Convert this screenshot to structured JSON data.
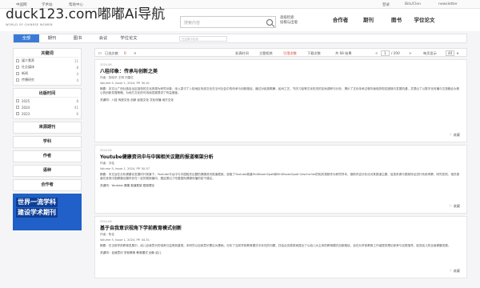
{
  "topbar": {
    "home": "中国网",
    "platform": "学术站",
    "help": "帮助中心",
    "right_a": "登录",
    "right_b": "Bits/Clen",
    "right_c": "newsletter"
  },
  "watermark": "duck123.com嘟嘟Ai导航",
  "logo_en": "WORLD OF CHINESE WOMEN",
  "search": {
    "placeholder": "搜索内容"
  },
  "header": {
    "link1": "高级检索",
    "link2": "投稿与出版"
  },
  "pubs": [
    "合作者",
    "期刊",
    "图书",
    "学位论文"
  ],
  "nav": {
    "tabs": [
      "全部",
      "期刊",
      "图书",
      "会议",
      "学位论文"
    ],
    "active": 0,
    "sub_placeholder": "在结果中检索"
  },
  "filters": [
    {
      "title": "关键词",
      "items": [
        {
          "label": "媒介素养",
          "count": "11"
        },
        {
          "label": "社交媒体",
          "count": "8"
        },
        {
          "label": "新闻",
          "count": "4"
        },
        {
          "label": "传播研究",
          "count": "4"
        }
      ]
    },
    {
      "title": "出版时间",
      "items": [
        {
          "label": "2025",
          "count": "8"
        },
        {
          "label": "2024",
          "count": "41"
        },
        {
          "label": "2023",
          "count": "6"
        }
      ]
    },
    {
      "title": "来源期刊",
      "items": []
    },
    {
      "title": "学科",
      "items": []
    },
    {
      "title": "作者",
      "items": []
    },
    {
      "title": "语种",
      "items": []
    },
    {
      "title": "合作者",
      "items": []
    }
  ],
  "banner": {
    "line1": "世界一流学科",
    "line2": "建设学术期刊"
  },
  "toolbar": {
    "select_all": "已选文献",
    "select_count": "0",
    "sort1": "发表时间",
    "sort2": "主题相关",
    "sort3": "引用次数",
    "sort4": "下载次数",
    "total": "共 68 结果",
    "pages": "/ 200",
    "per_page": "每页显示",
    "per_page_value": "40"
  },
  "results": [
    {
      "date": "2024-06",
      "title": "八桂印象：传承与创新之美",
      "author": "作者：张晓华 王明 刘建红",
      "journal": "Volume 5, Issue 1, 2024, PP. 30-41",
      "abstract": "摘要：本文以广西壮族自治区独特的文化资源为研究对象，深入探讨了八桂地区传统文化在当代社会中的传承与创新路径。通过对民族歌舞、民间工艺、节庆习俗等文化形态的实地调研与分析，揭示了文化传承过程中面临的现实困境与发展机遇，并提出了以数字化传播与文旅融合为核心的创新发展策略，为地方文化的可持续发展提供了有益借鉴。",
      "keywords": "关键词：八桂 传统文化 创新 民族文化 文化传播 地方文化",
      "fav": "收藏"
    },
    {
      "date": "2024-06",
      "title": "Youtube健康资讯中与中国相关议题的报道框架分析",
      "author": "作者：刘佳",
      "journal": "Volume 5, Issue 1, 2024, PP. 50-57",
      "abstract": "摘要：本文旨在分析健康化发展时代背景下，Youtube平台中与中国相关议题的健康资讯报道框架。选取了Youtube频道MnWissenSpaß和MnWissenSpaß Geschichte的相关视频作为研究样本，借助内容分析法对其报道主题、信息来源与框架特征进行系统考察。研究发现，相关报道在呈现中国健康议题时存在一定的框架偏向，据此提出了改善国际健康传播的若干建议。",
      "keywords": "关键词：Youtube 健康 报道框架 框架理论",
      "fav": "收藏"
    },
    {
      "date": "2024-06",
      "title": "基于自我意识视角下学前教育模式创新",
      "author": "作者：陈佳",
      "journal": "Volume 5, Issue 1, 2024, PP. 44-51",
      "abstract": "摘要：在当前学前教育发展中，幼儿自我意识的培养日益受到重视。本研究以自我意识理论为基础，分析了当前学前教育模式中存在的问题，并结合实践探索提出了以幼儿为主体的教育模式创新路径，旨在为学前教育工作者提供理论参考与实践指导，促进幼儿的全面健康发展。",
      "keywords": "关键词：自我意识 学前教育 教育模式 创新 幼儿",
      "fav": "收藏"
    }
  ]
}
